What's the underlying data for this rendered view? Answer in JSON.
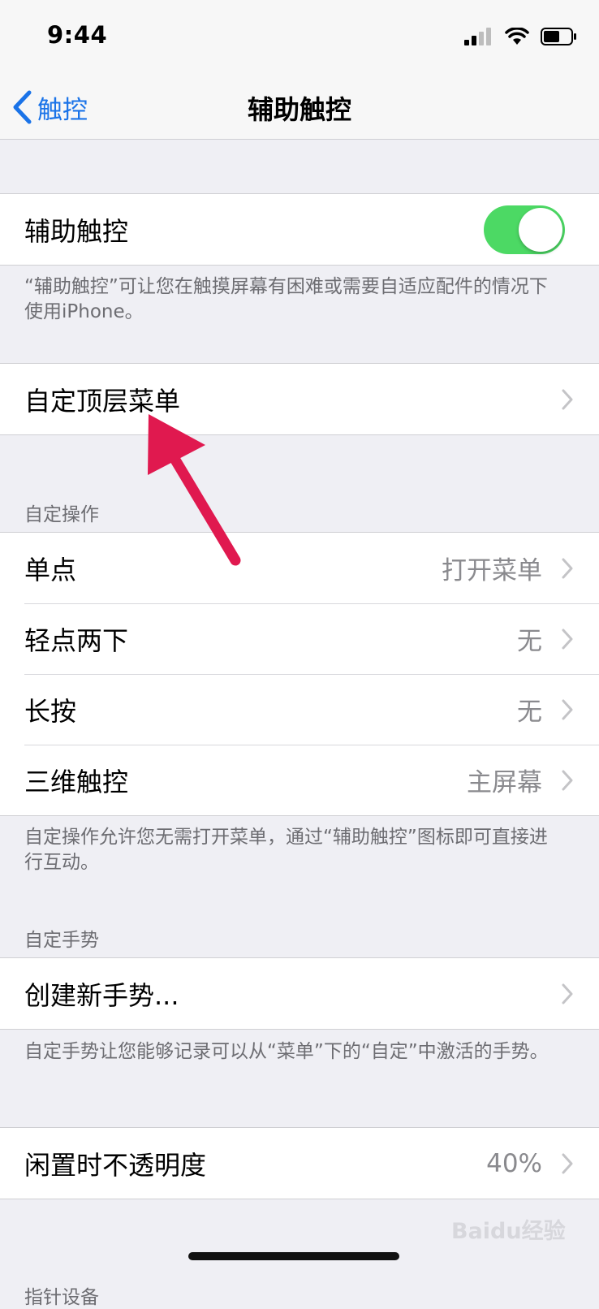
{
  "status_bar": {
    "time": "9:44"
  },
  "nav": {
    "back_label": "触控",
    "title": "辅助触控"
  },
  "assistive_touch": {
    "label": "辅助触控",
    "enabled": true,
    "toggle_color": "#4cd964",
    "description": "“辅助触控”可让您在触摸屏幕有困难或需要自适应配件的情况下使用iPhone。"
  },
  "top_menu": {
    "label": "自定顶层菜单"
  },
  "custom_actions": {
    "header": "自定操作",
    "items": [
      {
        "label": "单点",
        "value": "打开菜单"
      },
      {
        "label": "轻点两下",
        "value": "无"
      },
      {
        "label": "长按",
        "value": "无"
      },
      {
        "label": "三维触控",
        "value": "主屏幕"
      }
    ],
    "footer": "自定操作允许您无需打开菜单，通过“辅助触控”图标即可直接进行互动。"
  },
  "custom_gestures": {
    "header": "自定手势",
    "create_label": "创建新手势...",
    "footer": "自定手势让您能够记录可以从“菜单”下的“自定”中激活的手势。"
  },
  "idle_opacity": {
    "label": "闲置时不透明度",
    "value": "40%"
  },
  "next_section_header": "指针设备",
  "watermark": "Baidu经验",
  "annotation_arrow_color": "#e0194f",
  "accent_color": "#1a73e8"
}
